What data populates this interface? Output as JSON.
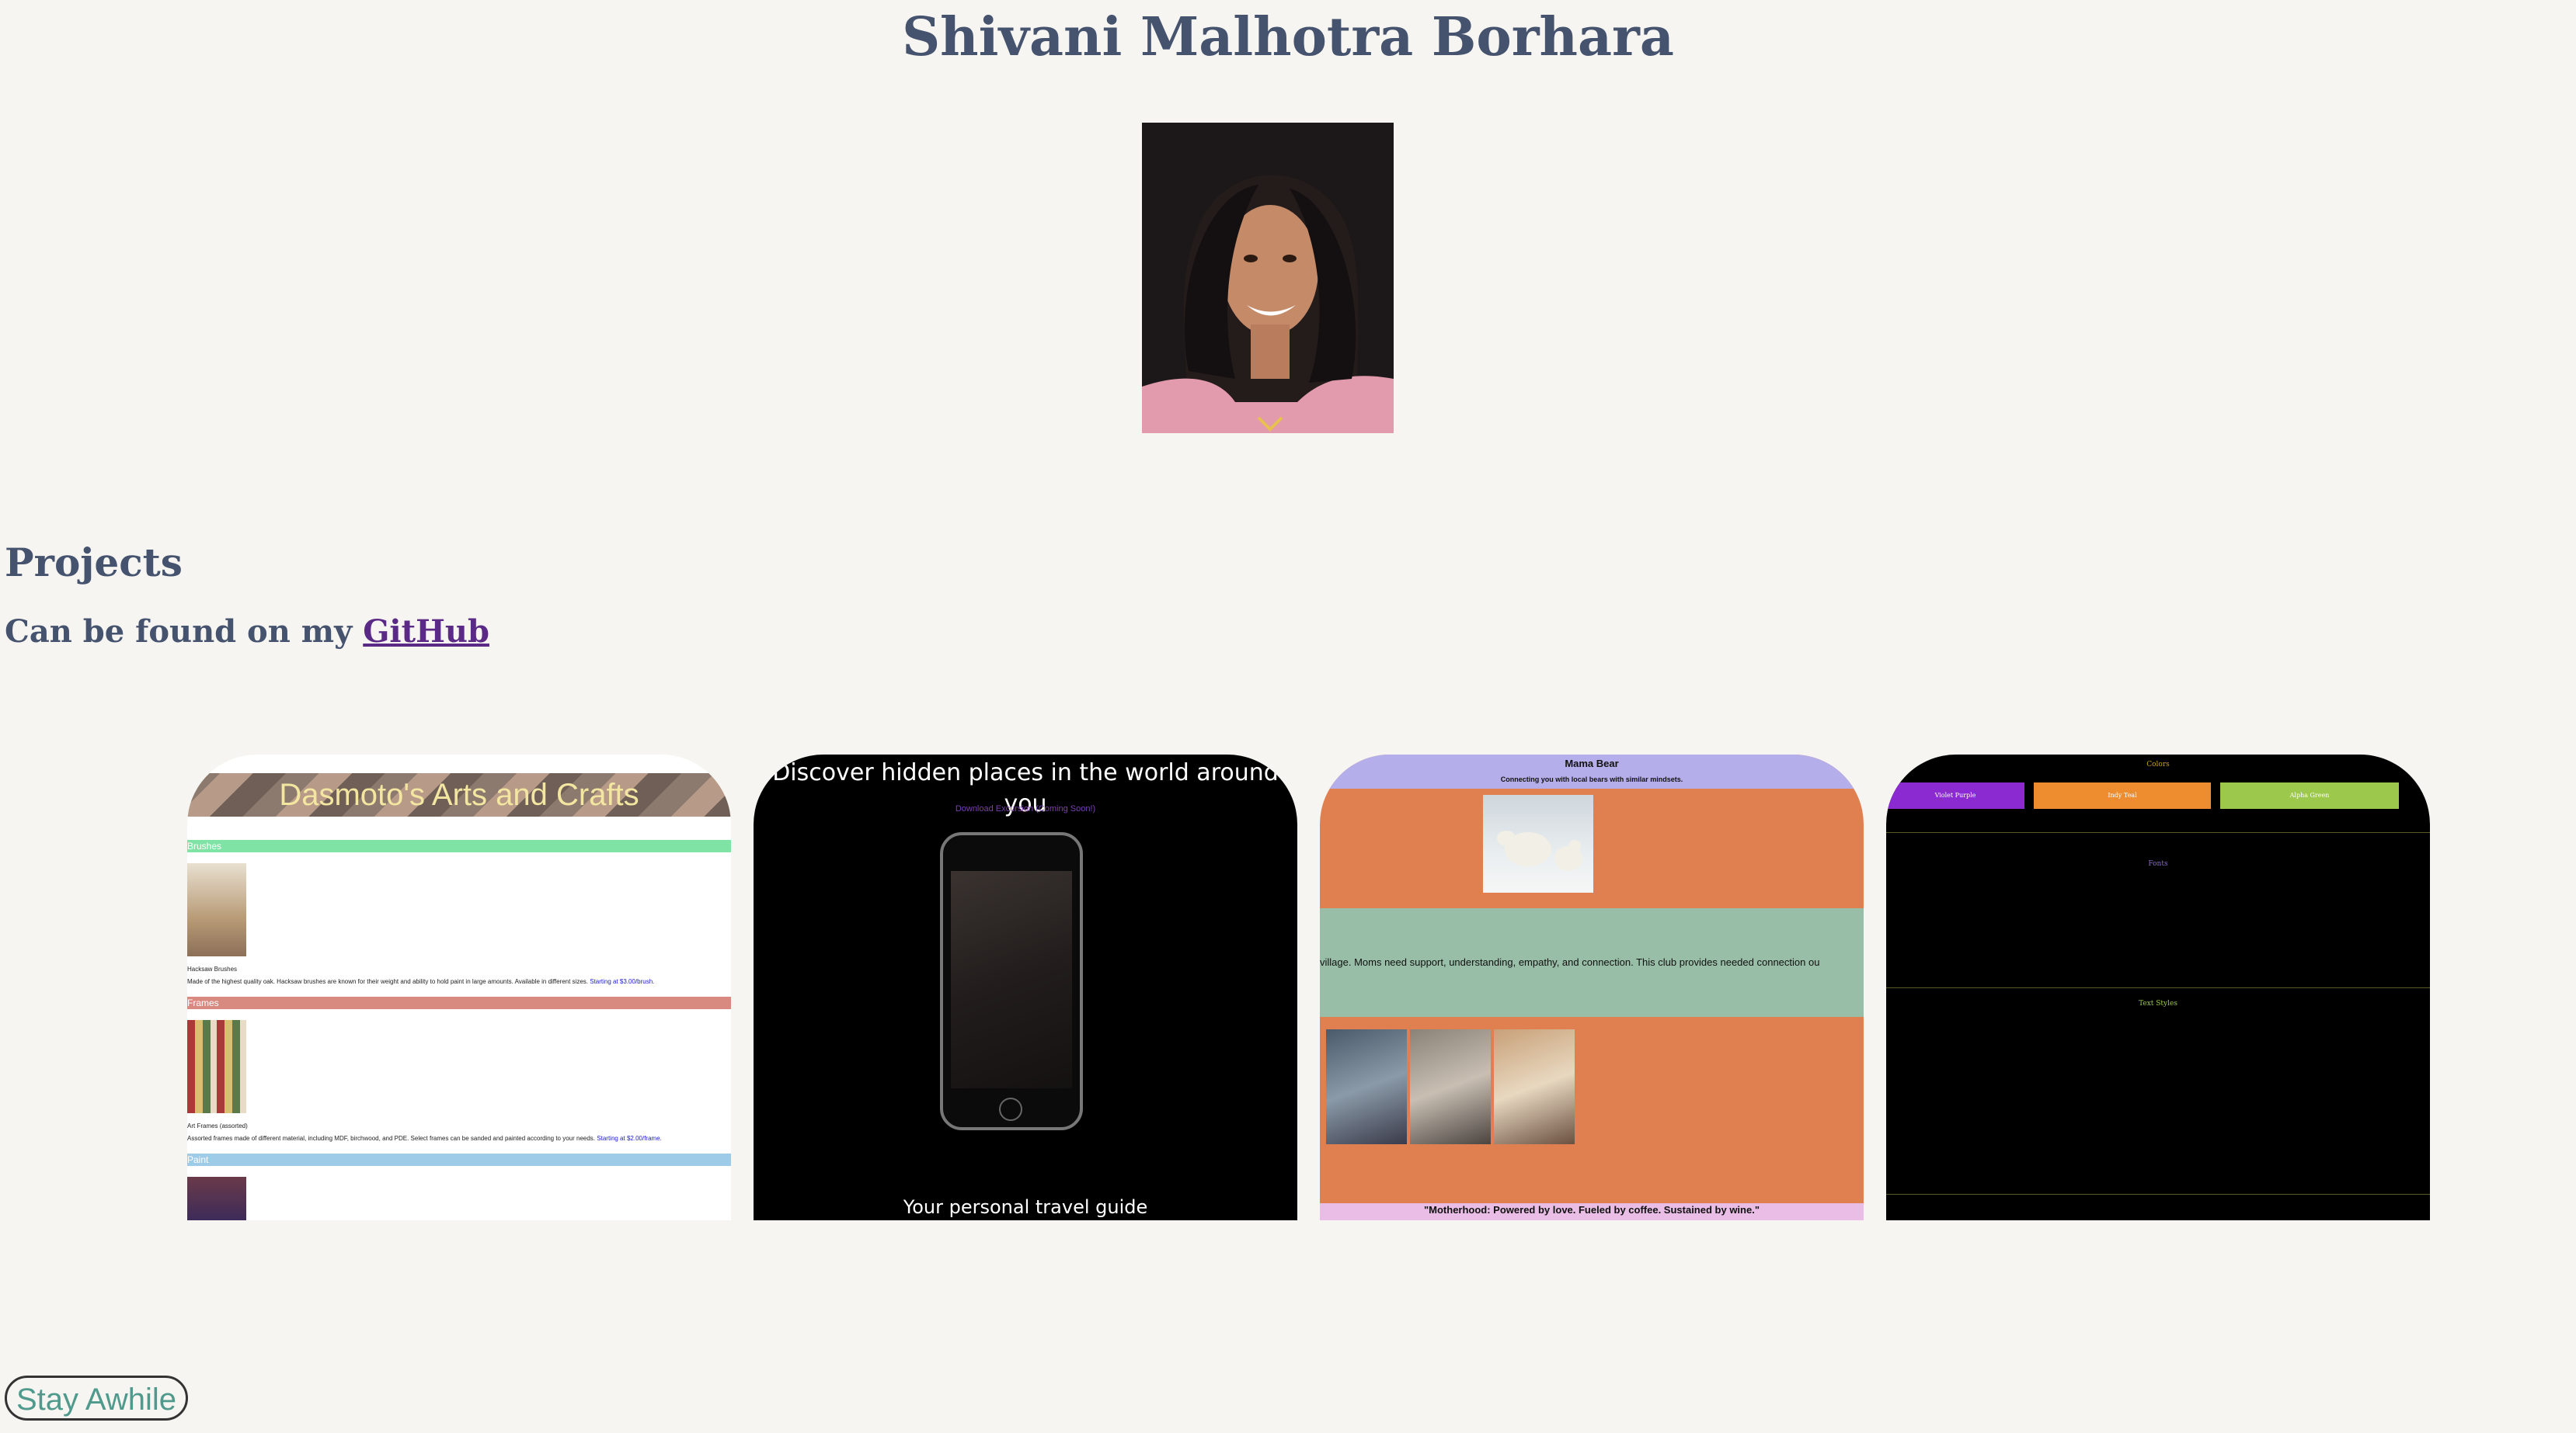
{
  "header": {
    "name": "Shivani Malhotra Borhara"
  },
  "projects": {
    "heading": "Projects",
    "subtitle_prefix": "Can be found on my",
    "github_link": "GitHub"
  },
  "thumbnails": [
    {
      "banner": "Dasmoto's Arts and Crafts",
      "sections": [
        "Brushes",
        "Frames",
        "Paint"
      ],
      "item1_title": "Hacksaw Brushes",
      "item1_desc": "Made of the highest quality oak. Hacksaw brushes are known for their weight and ability to hold paint in large amounts. Available in different sizes.",
      "item1_price": "Starting at $3.00/brush.",
      "item2_title": "Art Frames (assorted)",
      "item2_desc": "Assorted frames made of different material, including MDF, birchwood, and PDE. Select frames can be sanded and painted according to your needs.",
      "item2_price": "Starting at $2.00/frame."
    },
    {
      "headline": "Discover hidden places in the world around you",
      "link": "Download Excursion (Coming Soon!)",
      "tagline": "Your personal travel guide"
    },
    {
      "title": "Mama Bear",
      "subtitle": "Connecting you with local bears with similar mindsets.",
      "band_text": "village. Moms need support, understanding, empathy, and connection. This club provides needed connection ou",
      "quote": "\"Motherhood: Powered by love. Fueled by coffee. Sustained by wine.\""
    },
    {
      "colors_label": "Colors",
      "swatches": [
        "Violet Purple",
        "Indy Teal",
        "Alpha Green"
      ],
      "fonts_label": "Fonts",
      "text_styles_label": "Text Styles"
    }
  ],
  "button": {
    "label": "Stay Awhile"
  }
}
